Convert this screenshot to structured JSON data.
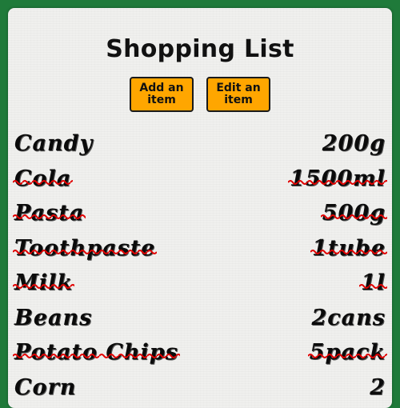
{
  "app": {
    "title": "Shopping List"
  },
  "buttons": {
    "add": "Add an item",
    "edit": "Edit an item"
  },
  "colors": {
    "background": "#1f7a3a",
    "paper": "#f0f0ee",
    "button": "#ffa600",
    "strike": "#e10000"
  },
  "items": [
    {
      "name": "Candy",
      "qty": "200g",
      "crossed_out": false
    },
    {
      "name": "Cola",
      "qty": "1500ml",
      "crossed_out": true
    },
    {
      "name": "Pasta",
      "qty": "500g",
      "crossed_out": true
    },
    {
      "name": "Toothpaste",
      "qty": "1tube",
      "crossed_out": true
    },
    {
      "name": "Milk",
      "qty": "1l",
      "crossed_out": true
    },
    {
      "name": "Beans",
      "qty": "2cans",
      "crossed_out": false
    },
    {
      "name": "Potato Chips",
      "qty": "5pack",
      "crossed_out": true
    },
    {
      "name": "Corn",
      "qty": "2",
      "crossed_out": false
    }
  ]
}
